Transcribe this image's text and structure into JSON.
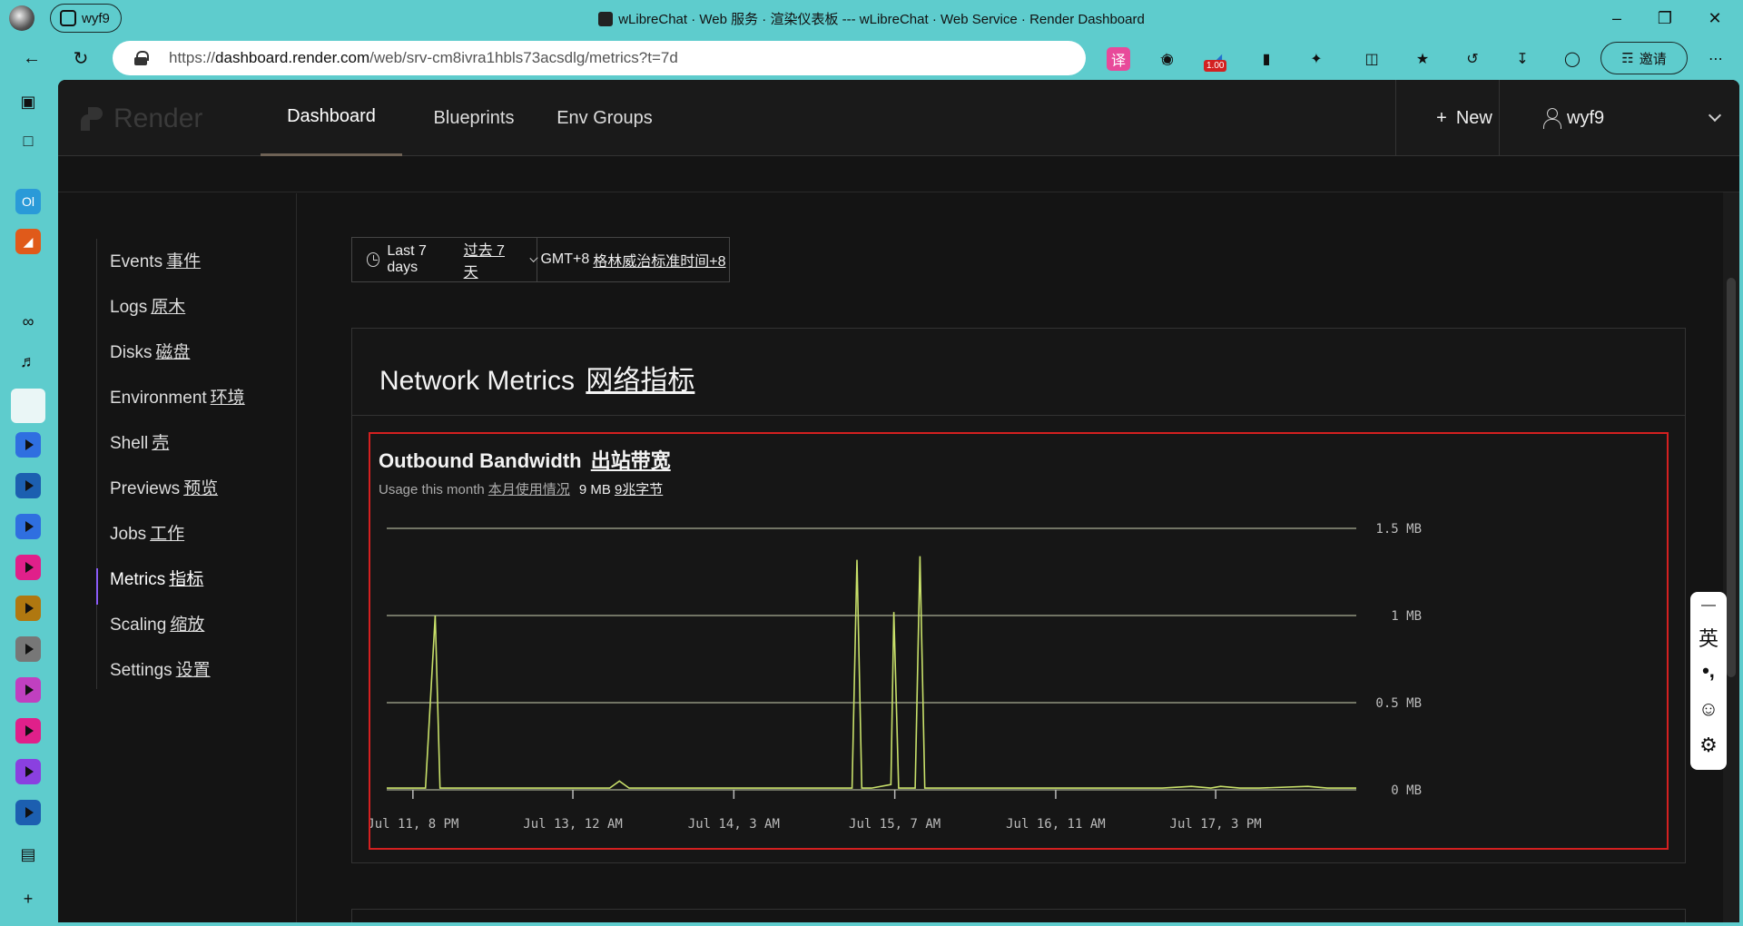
{
  "browser": {
    "profile_name": "wyf9",
    "window_title": "wLibreChat · Web 服务 · 渲染仪表板 --- wLibreChat · Web Service · Render Dashboard",
    "url_prefix": "https://",
    "url_domain": "dashboard.render.com",
    "url_path": "/web/srv-cm8ivra1hbls73acsdlg/metrics?t=7d",
    "extension_badge": "1.00",
    "invite_label": "邀请"
  },
  "header": {
    "logo_text": "Render",
    "tabs": [
      {
        "label": "Dashboard"
      },
      {
        "label": "Blueprints"
      },
      {
        "label": "Env Groups"
      }
    ],
    "new_label": "New",
    "user_label": "wyf9"
  },
  "sidebar": {
    "items": [
      {
        "en": "Events",
        "cn": "事件"
      },
      {
        "en": "Logs",
        "cn": "原木"
      },
      {
        "en": "Disks",
        "cn": "磁盘"
      },
      {
        "en": "Environment",
        "cn": "环境"
      },
      {
        "en": "Shell",
        "cn": "壳"
      },
      {
        "en": "Previews",
        "cn": "预览"
      },
      {
        "en": "Jobs",
        "cn": "工作"
      },
      {
        "en": "Metrics",
        "cn": "指标"
      },
      {
        "en": "Scaling",
        "cn": "缩放"
      },
      {
        "en": "Settings",
        "cn": "设置"
      }
    ],
    "active": "Metrics"
  },
  "filters": {
    "range_en": "Last 7 days",
    "range_cn": "过去 7 天",
    "tz_en": "GMT+8",
    "tz_cn": "格林威治标准时间+8"
  },
  "network": {
    "title_en": "Network Metrics",
    "title_cn": "网络指标"
  },
  "bandwidth": {
    "title_en": "Outbound Bandwidth",
    "title_cn": "出站带宽",
    "usage_en": "Usage this month",
    "usage_cn": "本月使用情况",
    "usage_value_en": "9 MB",
    "usage_value_cn": "9兆字节"
  },
  "ime": {
    "mode": "英",
    "punct": "•,"
  },
  "chart_data": {
    "type": "line",
    "title": "Outbound Bandwidth",
    "ylim": [
      0,
      1.5
    ],
    "y_ticks": [
      "1.5 MB",
      "1 MB",
      "0.5 MB",
      "0 MB"
    ],
    "x_ticks": [
      "Jul 11, 8 PM",
      "Jul 13, 12 AM",
      "Jul 14, 3 AM",
      "Jul 15, 7 AM",
      "Jul 16, 11 AM",
      "Jul 17, 3 PM"
    ],
    "grid": true,
    "line_color": "#c8e06a",
    "series": [
      {
        "x": [
          0,
          0.04,
          0.05,
          0.055,
          0.2,
          0.23,
          0.24,
          0.25,
          0.4,
          0.45,
          0.475,
          0.48,
          0.485,
          0.49,
          0.5,
          0.52,
          0.523,
          0.528,
          0.53,
          0.545,
          0.55,
          0.555,
          0.56,
          0.57,
          0.6,
          0.8,
          0.83,
          0.85,
          0.86,
          0.88,
          0.9,
          0.95,
          0.97,
          1.0
        ],
        "values": [
          0.01,
          0.01,
          1.0,
          0.01,
          0.01,
          0.01,
          0.05,
          0.01,
          0.01,
          0.01,
          0.01,
          0.01,
          1.32,
          0.01,
          0.01,
          0.03,
          1.02,
          0.01,
          0.01,
          0.01,
          1.34,
          0.01,
          0.01,
          0.01,
          0.01,
          0.01,
          0.02,
          0.01,
          0.02,
          0.01,
          0.01,
          0.02,
          0.01,
          0.01
        ]
      }
    ]
  }
}
